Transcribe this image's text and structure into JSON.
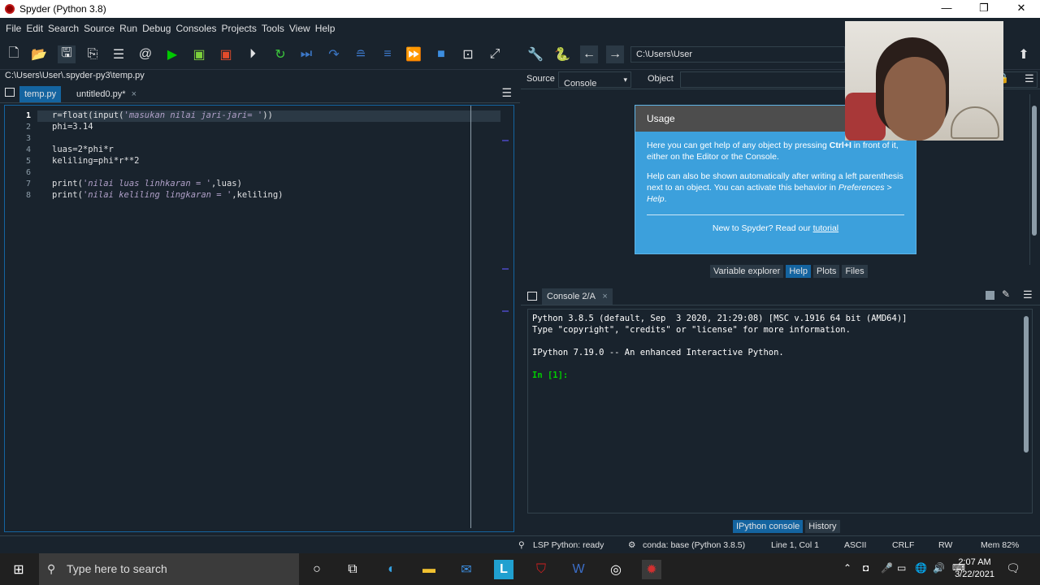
{
  "window": {
    "title": "Spyder (Python 3.8)",
    "min": "—",
    "max": "❐",
    "close": "✕"
  },
  "menu": [
    "File",
    "Edit",
    "Search",
    "Source",
    "Run",
    "Debug",
    "Consoles",
    "Projects",
    "Tools",
    "View",
    "Help"
  ],
  "toolbar": {
    "path": "C:\\Users\\User"
  },
  "editor": {
    "filepath": "C:\\Users\\User\\.spyder-py3\\temp.py",
    "tabs": [
      {
        "label": "temp.py",
        "close": "×"
      },
      {
        "label": "untitled0.py*",
        "close": "×"
      }
    ],
    "lines": [
      {
        "num": "1",
        "pre": "r=float(input(",
        "str": "'masukan nilai jari-jari= '",
        "post": "))"
      },
      {
        "num": "2",
        "pre": "phi=3.14",
        "str": "",
        "post": ""
      },
      {
        "num": "3",
        "pre": "",
        "str": "",
        "post": ""
      },
      {
        "num": "4",
        "pre": "luas=2*phi*r",
        "str": "",
        "post": ""
      },
      {
        "num": "5",
        "pre": "keliling=phi*r**2",
        "str": "",
        "post": ""
      },
      {
        "num": "6",
        "pre": "",
        "str": "",
        "post": ""
      },
      {
        "num": "7",
        "pre": "print(",
        "str": "'nilai luas linhkaran = '",
        "post": ",luas)"
      },
      {
        "num": "8",
        "pre": "print(",
        "str": "'nilai keliling lingkaran = '",
        "post": ",keliling)"
      }
    ]
  },
  "help": {
    "source_label": "Source",
    "source_value": "Console",
    "object_label": "Object",
    "usage_title": "Usage",
    "p1_a": "Here you can get help of any object by pressing ",
    "p1_key": "Ctrl+I",
    "p1_b": " in front of it, either on the Editor or the Console.",
    "p2_a": "Help can also be shown automatically after writing a left parenthesis next to an object. You can activate this behavior in ",
    "p2_pref": "Preferences > Help",
    "p2_b": ".",
    "footer_text": "New to Spyder? Read our ",
    "footer_link": "tutorial",
    "tabs": [
      "Variable explorer",
      "Help",
      "Plots",
      "Files"
    ]
  },
  "console": {
    "tab_label": "Console 2/A",
    "tab_close": "×",
    "lines": [
      "Python 3.8.5 (default, Sep  3 2020, 21:29:08) [MSC v.1916 64 bit (AMD64)]",
      "Type \"copyright\", \"credits\" or \"license\" for more information.",
      "",
      "IPython 7.19.0 -- An enhanced Interactive Python."
    ],
    "prompt": "In [1]:",
    "bottom_tabs": [
      "IPython console",
      "History"
    ]
  },
  "status": {
    "lsp": "LSP Python: ready",
    "conda": "conda: base (Python 3.8.5)",
    "cursor": "Line 1, Col 1",
    "encoding": "ASCII",
    "eol": "CRLF",
    "rw": "RW",
    "mem": "Mem 82%"
  },
  "taskbar": {
    "search_placeholder": "Type here to search",
    "time": "2:07 AM",
    "date": "3/22/2021"
  }
}
